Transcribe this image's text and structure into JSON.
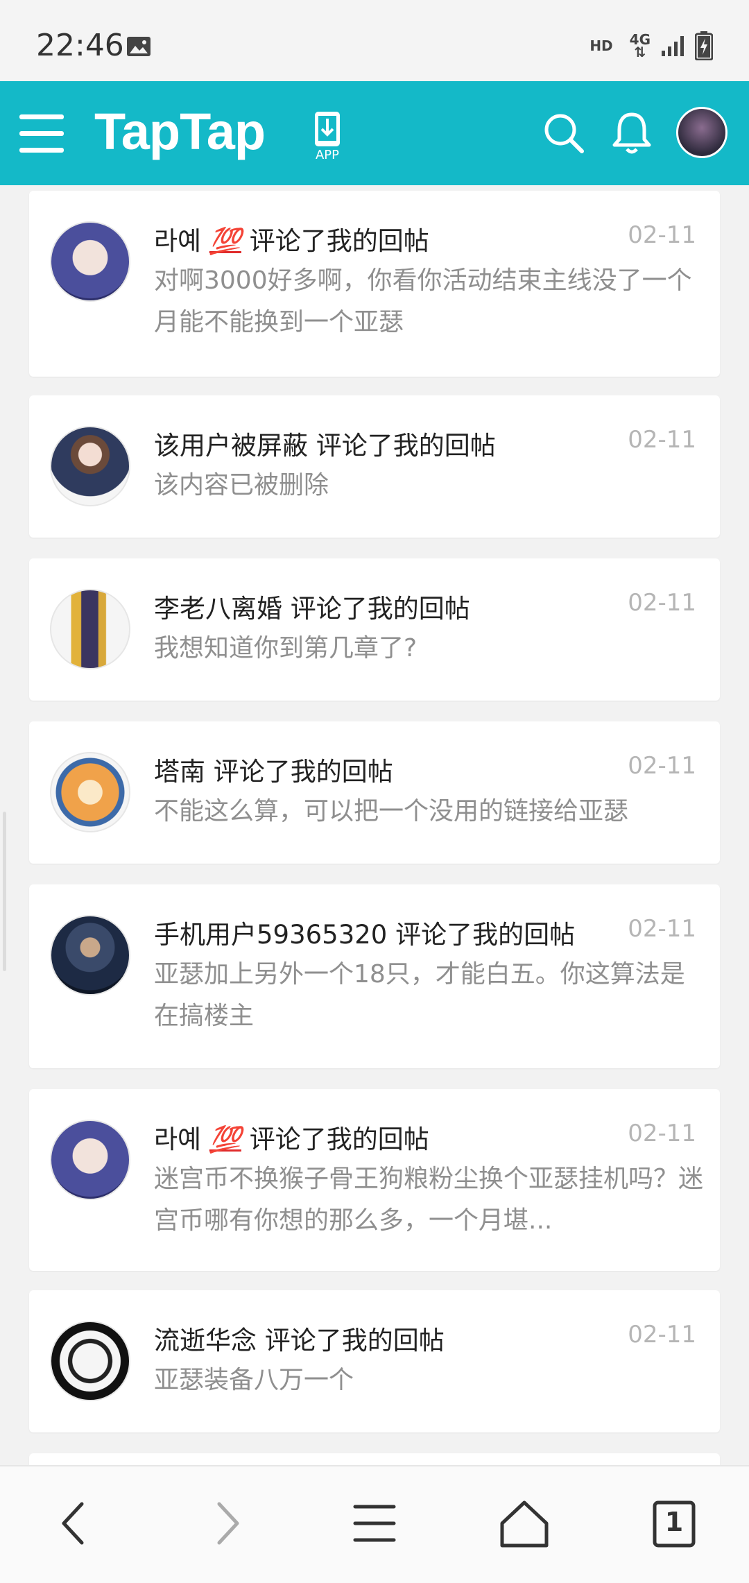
{
  "status_bar": {
    "time": "22:46",
    "hd": "HD",
    "network": "4G",
    "icons": [
      "image-icon",
      "signal-icon",
      "battery-charging-icon"
    ]
  },
  "header": {
    "logo": "TapTap",
    "app_label": "APP",
    "brand_color": "#14b9c8",
    "icons": [
      "menu-icon",
      "app-download-icon",
      "search-icon",
      "bell-icon"
    ]
  },
  "notifications": [
    {
      "user": "라예",
      "badge": "💯",
      "action": "评论了我的回帖",
      "date": "02-11",
      "text": "对啊3000好多啊，你看你活动结束主线没了一个月能不能换到一个亚瑟"
    },
    {
      "user": "该用户被屏蔽",
      "badge": "",
      "action": "评论了我的回帖",
      "date": "02-11",
      "text": "该内容已被删除"
    },
    {
      "user": "李老八离婚",
      "badge": "",
      "action": "评论了我的回帖",
      "date": "02-11",
      "text": "我想知道你到第几章了?"
    },
    {
      "user": "塔南",
      "badge": "",
      "action": "评论了我的回帖",
      "date": "02-11",
      "text": "不能这么算，可以把一个没用的链接给亚瑟"
    },
    {
      "user": "手机用户59365320",
      "badge": "",
      "action": "评论了我的回帖",
      "date": "02-11",
      "text": "亚瑟加上另外一个18只，才能白五。你这算法是在搞楼主"
    },
    {
      "user": "라예",
      "badge": "💯",
      "action": "评论了我的回帖",
      "date": "02-11",
      "text": "迷宫币不换猴子骨王狗粮粉尘换个亚瑟挂机吗？迷宫币哪有你想的那么多，一个月堪..."
    },
    {
      "user": "流逝华念",
      "badge": "",
      "action": "评论了我的回帖",
      "date": "02-11",
      "text": "亚瑟装备八万一个"
    }
  ],
  "bottom_nav": {
    "tab_count": "1",
    "icons": [
      "back-icon",
      "forward-icon",
      "menu-lines-icon",
      "home-icon",
      "tabs-icon"
    ]
  }
}
